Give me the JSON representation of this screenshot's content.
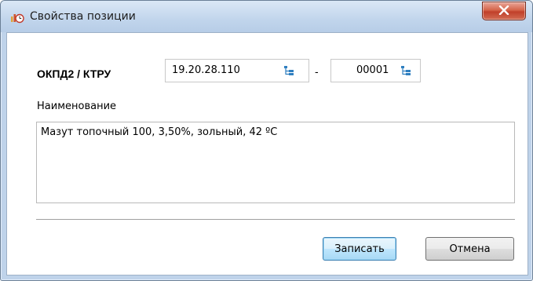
{
  "window": {
    "title": "Свойства позиции",
    "close_label": "x"
  },
  "form": {
    "okpd_label": "ОКПД2 / КТРУ",
    "okpd_value": "19.20.28.110",
    "separator": "-",
    "ktru_value": "00001",
    "name_label": "Наименование",
    "name_value": "Мазут топочный 100, 3,50%, зольный, 42 ºС"
  },
  "buttons": {
    "save_label": "Записать",
    "cancel_label": "Отмена"
  },
  "icons": {
    "app": "chart-clock-icon",
    "tree": "tree-select-icon",
    "close": "close-icon"
  },
  "colors": {
    "titlebar": "#c1d5ec",
    "close_button": "#c0402a",
    "default_button_border": "#3c7fb1",
    "tree_icon": "#2f7fc0"
  }
}
